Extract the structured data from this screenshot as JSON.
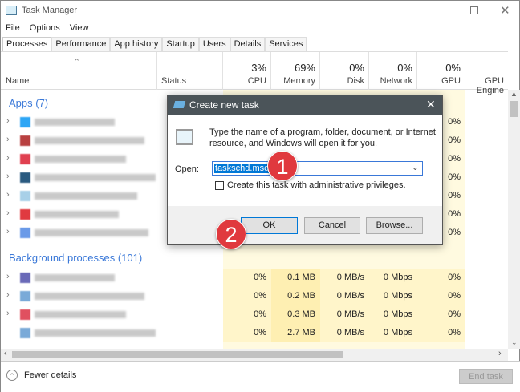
{
  "window": {
    "title": "Task Manager",
    "controls": [
      "minimize",
      "maximize",
      "close"
    ]
  },
  "menu": [
    "File",
    "Options",
    "View"
  ],
  "tabs": [
    "Processes",
    "Performance",
    "App history",
    "Startup",
    "Users",
    "Details",
    "Services"
  ],
  "columns": {
    "name": "Name",
    "status": "Status",
    "cpu": {
      "pct": "3%",
      "label": "CPU"
    },
    "memory": {
      "pct": "69%",
      "label": "Memory"
    },
    "disk": {
      "pct": "0%",
      "label": "Disk"
    },
    "network": {
      "pct": "0%",
      "label": "Network"
    },
    "gpu": {
      "pct": "0%",
      "label": "GPU"
    },
    "gpu_engine": "GPU Engine"
  },
  "groups": {
    "apps": "Apps (7)",
    "background": "Background processes (101)"
  },
  "apps_rows": [
    {
      "icon_color": "#2ea6f5",
      "gpu": "0%"
    },
    {
      "icon_color": "#b84040",
      "gpu": "0%"
    },
    {
      "icon_color": "#e04050",
      "gpu": "0%"
    },
    {
      "icon_color": "#2a5a80",
      "gpu": "0%"
    },
    {
      "icon_color": "#a8d0e8",
      "gpu": "0%"
    },
    {
      "icon_color": "#e03a40",
      "gpu": "0%"
    },
    {
      "icon_color": "#6a9ae8",
      "gpu": "0%"
    }
  ],
  "bg_rows": [
    {
      "icon_color": "#6a6ab8",
      "cpu": "0%",
      "memory": "0.1 MB",
      "disk": "0 MB/s",
      "network": "0 Mbps",
      "gpu": "0%"
    },
    {
      "icon_color": "#7aaad8",
      "cpu": "0%",
      "memory": "0.2 MB",
      "disk": "0 MB/s",
      "network": "0 Mbps",
      "gpu": "0%"
    },
    {
      "icon_color": "#e05060",
      "cpu": "0%",
      "memory": "0.3 MB",
      "disk": "0 MB/s",
      "network": "0 Mbps",
      "gpu": "0%"
    },
    {
      "icon_color": "#7aaad8",
      "cpu": "0%",
      "memory": "2.7 MB",
      "disk": "0 MB/s",
      "network": "0 Mbps",
      "gpu": "0%"
    }
  ],
  "footer": {
    "fewer_details": "Fewer details",
    "end_task": "End task"
  },
  "dialog": {
    "title": "Create new task",
    "message": "Type the name of a program, folder, document, or Internet resource, and Windows will open it for you.",
    "open_label": "Open:",
    "open_value": "taskschd.msc",
    "checkbox_label": "Create this task with administrative privileges.",
    "checkbox_checked": false,
    "ok": "OK",
    "cancel": "Cancel",
    "browse": "Browse..."
  },
  "annotations": [
    "1",
    "2"
  ],
  "colors": {
    "accent": "#3a78d8",
    "badge": "#e0393e",
    "dialog_title": "#4b5459",
    "heat": "#fff4c4"
  }
}
